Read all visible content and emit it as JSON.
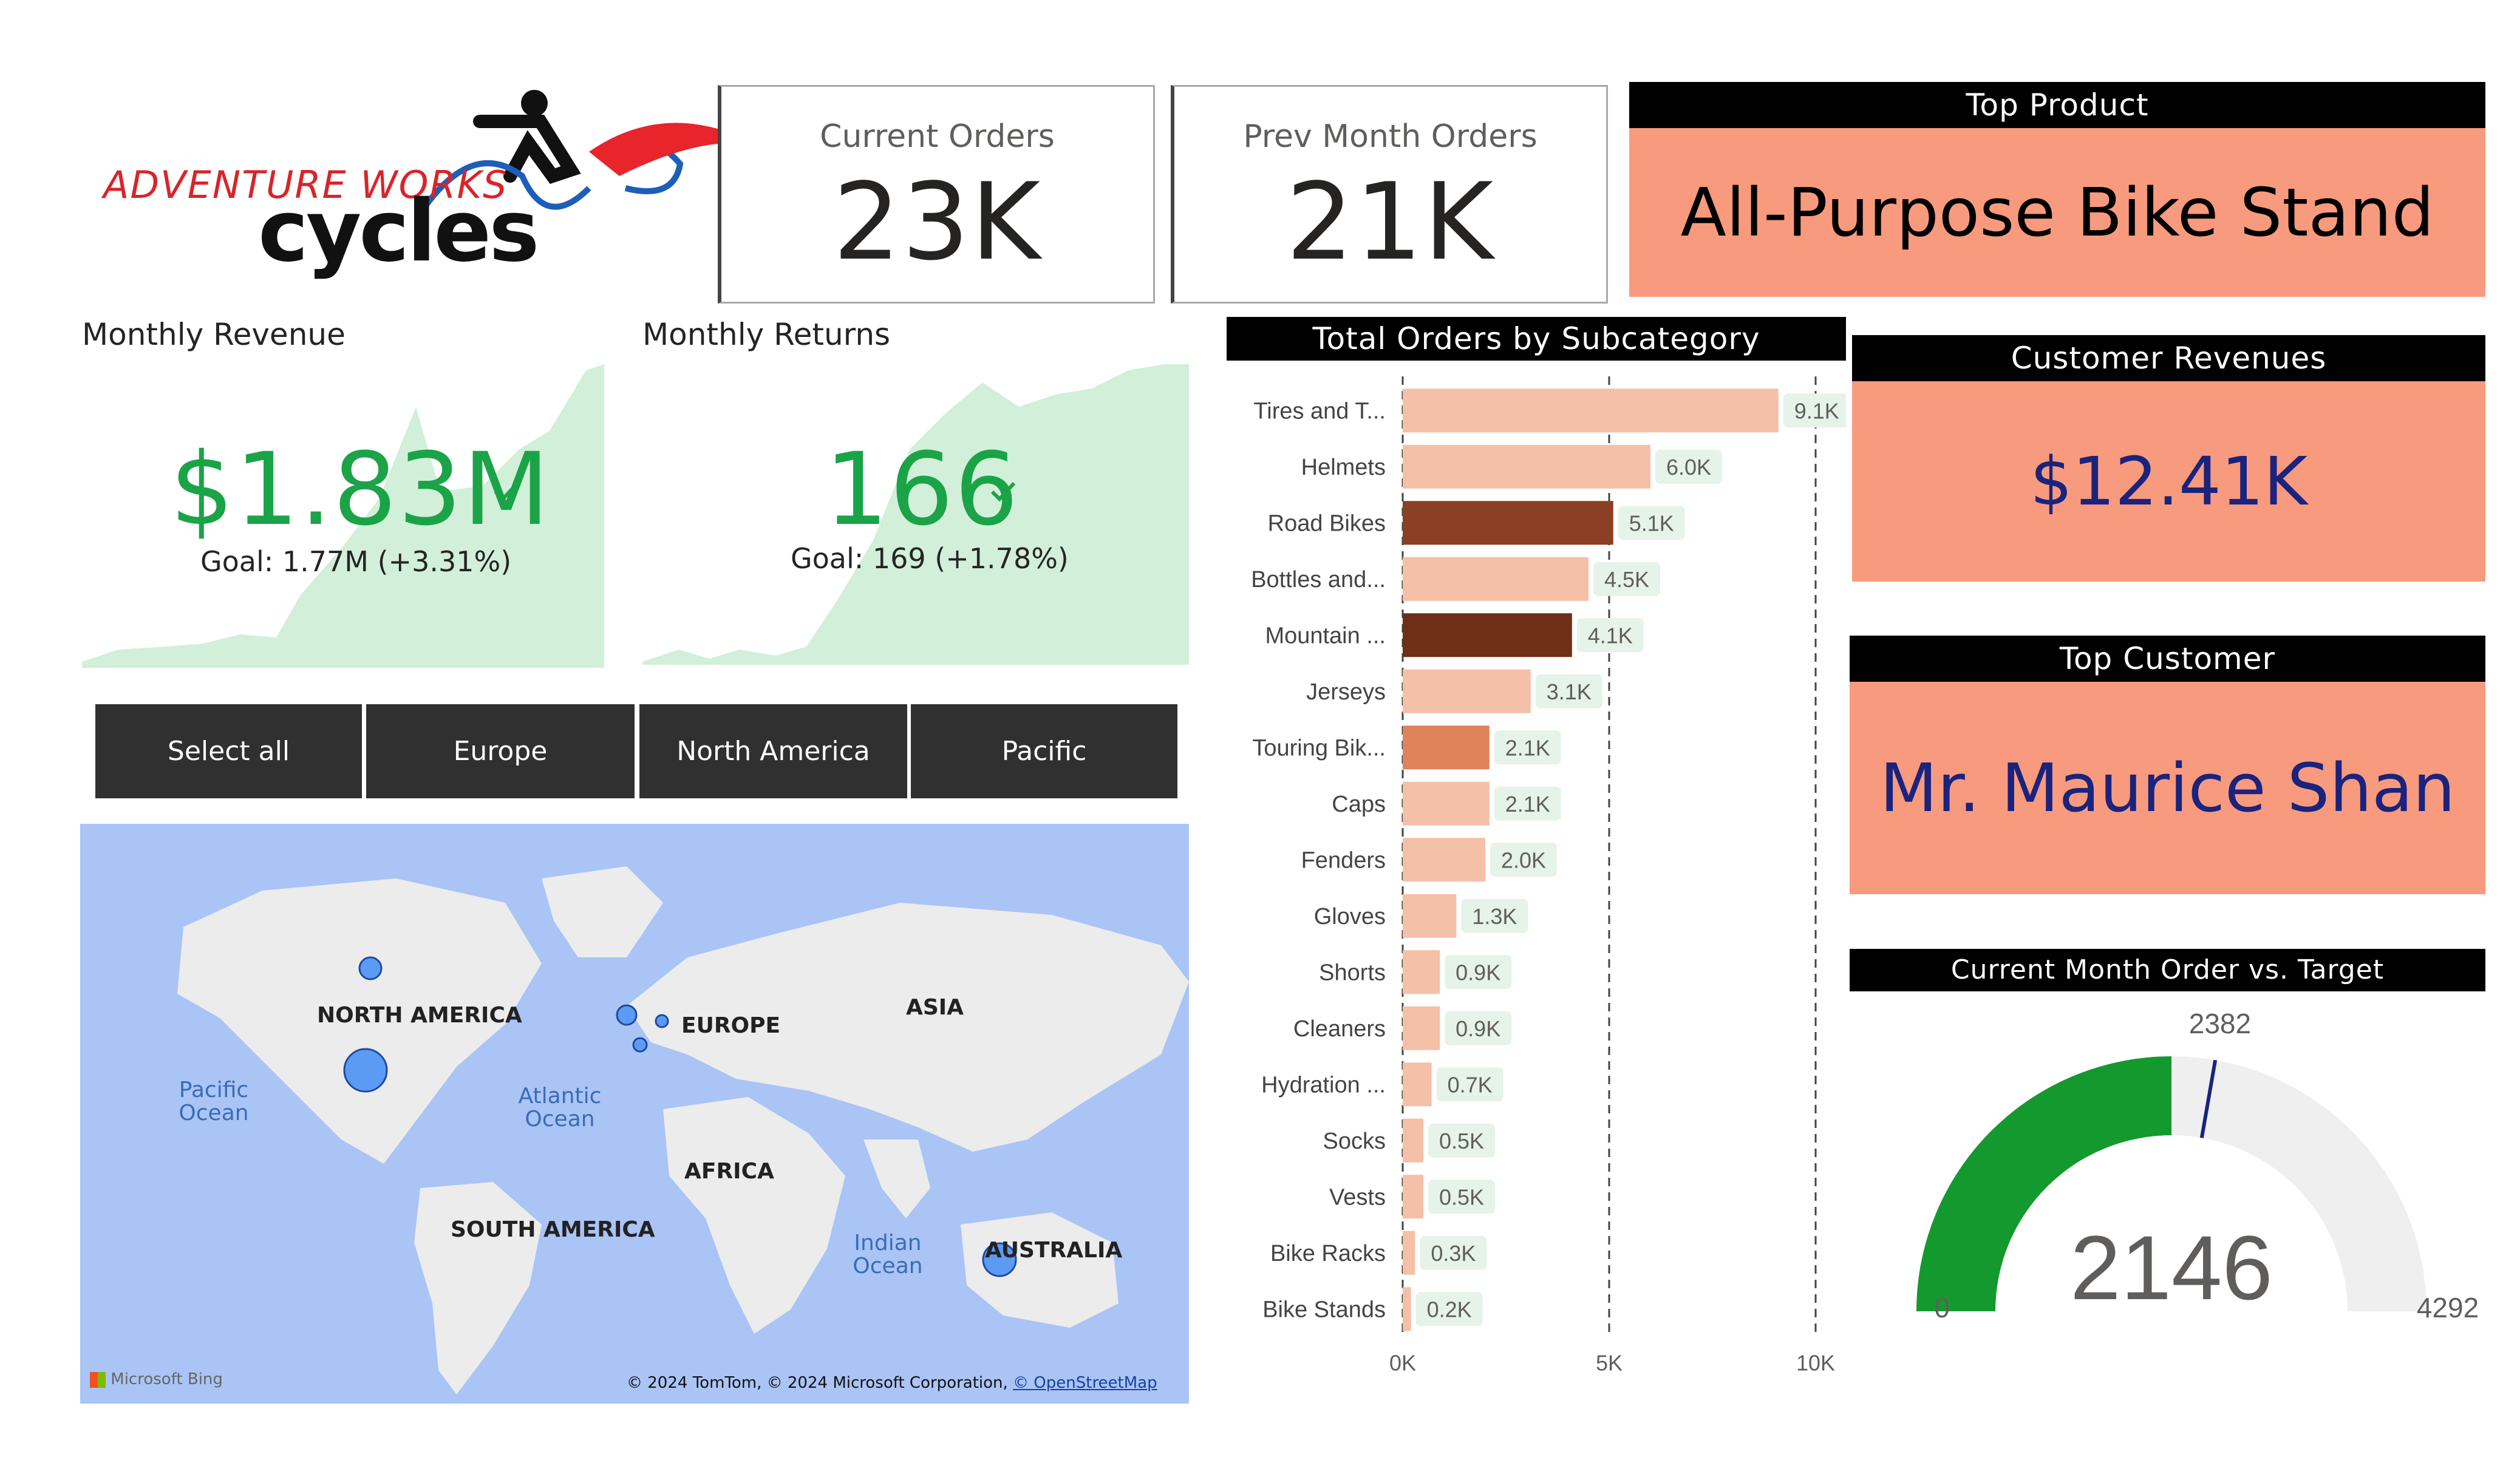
{
  "logo": {
    "line1": "ADVENTURE WORKS",
    "line2": "cycles"
  },
  "kpis": {
    "current_orders": {
      "label": "Current Orders",
      "value": "23K"
    },
    "prev_month_orders": {
      "label": "Prev Month Orders",
      "value": "21K"
    }
  },
  "top_product": {
    "title": "Top Product",
    "value": "All-Purpose Bike Stand"
  },
  "customer_revenues": {
    "title": "Customer Revenues",
    "value": "$12.41K"
  },
  "top_customer": {
    "title": "Top Customer",
    "value": "Mr. Maurice Shan"
  },
  "monthly_revenue": {
    "title": "Monthly Revenue",
    "value": "$1.83M",
    "goal": "Goal: 1.77M (+3.31%)"
  },
  "monthly_returns": {
    "title": "Monthly Returns",
    "value": "166",
    "goal": "Goal: 169 (+1.78%)"
  },
  "slicer": {
    "items": [
      "Select all",
      "Europe",
      "North America",
      "Pacific"
    ]
  },
  "map": {
    "labels": {
      "north_america": "NORTH AMERICA",
      "europe": "EUROPE",
      "asia": "ASIA",
      "africa": "AFRICA",
      "south_america": "SOUTH AMERICA",
      "australia": "AUSTRALIA"
    },
    "oceans": {
      "pacific": "Pacific Ocean",
      "atlantic": "Atlantic Ocean",
      "indian": "Indian Ocean"
    },
    "attribution": "© 2024 TomTom, © 2024 Microsoft Corporation,",
    "attribution_link": "© OpenStreetMap",
    "bing": "Microsoft Bing"
  },
  "gauge": {
    "title": "Current Month Order vs. Target",
    "value": 2146,
    "value_label": "2146",
    "min": 0,
    "min_label": "0",
    "max": 4292,
    "max_label": "4292",
    "target": 2382,
    "target_label": "2382",
    "fill_color": "#14992e",
    "track_color": "#efefef",
    "target_color": "#1a237e"
  },
  "chart_data": {
    "type": "bar",
    "orientation": "horizontal",
    "title": "Total Orders by Subcategory",
    "categories": [
      "Tires and T...",
      "Helmets",
      "Road Bikes",
      "Bottles and...",
      "Mountain ...",
      "Jerseys",
      "Touring Bik...",
      "Caps",
      "Fenders",
      "Gloves",
      "Shorts",
      "Cleaners",
      "Hydration ...",
      "Socks",
      "Vests",
      "Bike Racks",
      "Bike Stands"
    ],
    "values": [
      9100,
      6000,
      5100,
      4500,
      4100,
      3100,
      2100,
      2100,
      2000,
      1300,
      900,
      900,
      700,
      500,
      500,
      300,
      200
    ],
    "data_labels": [
      "9.1K",
      "6.0K",
      "5.1K",
      "4.5K",
      "4.1K",
      "3.1K",
      "2.1K",
      "2.1K",
      "2.0K",
      "1.3K",
      "0.9K",
      "0.9K",
      "0.7K",
      "0.5K",
      "0.5K",
      "0.3K",
      "0.2K"
    ],
    "colors": [
      "#f4c0a7",
      "#f4c0a7",
      "#8b3f24",
      "#f4c0a7",
      "#6e2e18",
      "#f4c0a7",
      "#e0825a",
      "#f4c0a7",
      "#f4c0a7",
      "#f4c0a7",
      "#f4c0a7",
      "#f4c0a7",
      "#f4c0a7",
      "#f4c0a7",
      "#f4c0a7",
      "#f4c0a7",
      "#f4c0a7"
    ],
    "xticks": [
      "0K",
      "5K",
      "10K"
    ],
    "xtick_values": [
      0,
      5000,
      10000
    ],
    "xlim": [
      0,
      10000
    ],
    "grid": "dashed vertical"
  },
  "colors": {
    "accent_green": "#1aa447",
    "salmon": "#f89a7d",
    "navy": "#1a237e",
    "slicer_bg": "#303030"
  }
}
